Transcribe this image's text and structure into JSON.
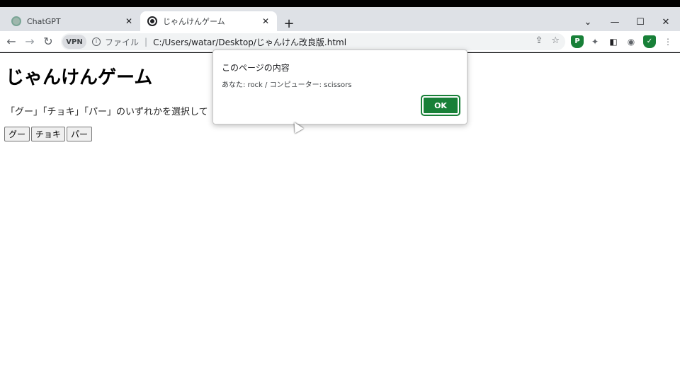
{
  "tabs": [
    {
      "title": "ChatGPT",
      "active": false
    },
    {
      "title": "じゃんけんゲーム",
      "active": true
    }
  ],
  "toolbar": {
    "vpn_label": "VPN",
    "file_label": "ファイル",
    "url": "C:/Users/watar/Desktop/じゃんけん改良版.html"
  },
  "page": {
    "heading": "じゃんけんゲーム",
    "instruction": "「グー」「チョキ」「パー」のいずれかを選択して",
    "buttons": [
      "グー",
      "チョキ",
      "パー"
    ]
  },
  "dialog": {
    "title": "このページの内容",
    "message": "あなた: rock / コンピューター: scissors",
    "ok_label": "OK"
  },
  "colors": {
    "ok_button": "#188038",
    "tabstrip": "#dee1e6"
  }
}
